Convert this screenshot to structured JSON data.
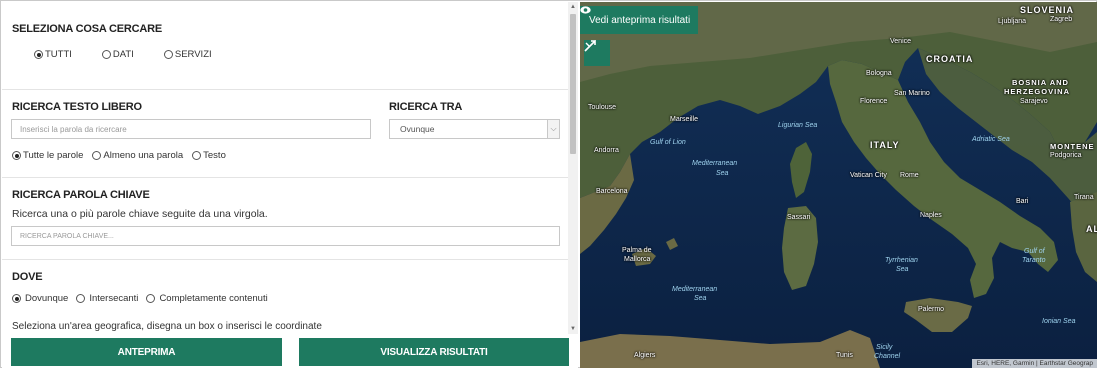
{
  "search_type": {
    "title": "SELEZIONA COSA CERCARE",
    "options": [
      {
        "label": "TUTTI",
        "selected": true
      },
      {
        "label": "DATI",
        "selected": false
      },
      {
        "label": "SERVIZI",
        "selected": false
      }
    ]
  },
  "free_text": {
    "title": "RICERCA TESTO LIBERO",
    "placeholder": "Inserisci la parola da ricercare",
    "options": [
      {
        "label": "Tutte le parole",
        "selected": true
      },
      {
        "label": "Almeno una parola",
        "selected": false
      },
      {
        "label": "Testo",
        "selected": false
      }
    ]
  },
  "search_in": {
    "title": "RICERCA TRA",
    "selected": "Ovunque"
  },
  "keyword": {
    "title": "RICERCA PAROLA CHIAVE",
    "description": "Ricerca una o più parole chiave seguite da una virgola.",
    "placeholder": "RICERCA PAROLA CHIAVE..."
  },
  "where": {
    "title": "DOVE",
    "options": [
      {
        "label": "Dovunque",
        "selected": true
      },
      {
        "label": "Intersecanti",
        "selected": false
      },
      {
        "label": "Completamente contenuti",
        "selected": false
      }
    ],
    "description": "Seleziona un'area geografica, disegna un box o inserisci le coordinate"
  },
  "buttons": {
    "preview": "ANTEPRIMA",
    "results": "VISUALIZZA RISULTATI"
  },
  "map": {
    "preview_button": "Vedi anteprima risultati",
    "attribution": "Esri, HERE, Garmin | Earthstar Geograp",
    "labels": {
      "slovenia": "SLOVENIA",
      "ljubljana": "Ljubljana",
      "zagreb": "Zagreb",
      "venice": "Venice",
      "croatia": "CROATIA",
      "bosnia1": "BOSNIA AND",
      "bosnia2": "HERZEGOVINA",
      "sarajevo": "Sarajevo",
      "montenegro": "MONTENE",
      "podgorica": "Podgorica",
      "tirana": "Tirana",
      "bologna": "Bologna",
      "san_marino": "San Marino",
      "florence": "Florence",
      "toulouse": "Toulouse",
      "marseille": "Marseille",
      "ligurian_sea": "Ligurian Sea",
      "gulf_lion": "Gulf of Lion",
      "andorra": "Andorra",
      "italy": "ITALY",
      "adriatic": "Adriatic Sea",
      "med1_a": "Mediterranean",
      "med1_b": "Sea",
      "vatican": "Vatican City",
      "rome": "Rome",
      "barcelona": "Barcelona",
      "bari": "Bari",
      "naples": "Naples",
      "sassari": "Sassari",
      "palma1": "Palma de",
      "palma2": "Mallorca",
      "tyrr1": "Tyrrhenian",
      "tyrr2": "Sea",
      "taranto1": "Gulf of",
      "taranto2": "Taranto",
      "med2_a": "Mediterranean",
      "med2_b": "Sea",
      "palermo": "Palermo",
      "ionian": "Ionian Sea",
      "algiers": "Algiers",
      "tunis": "Tunis",
      "sicily1": "Sicily",
      "sicily2": "Channel",
      "albania_abbr": "AL"
    }
  }
}
